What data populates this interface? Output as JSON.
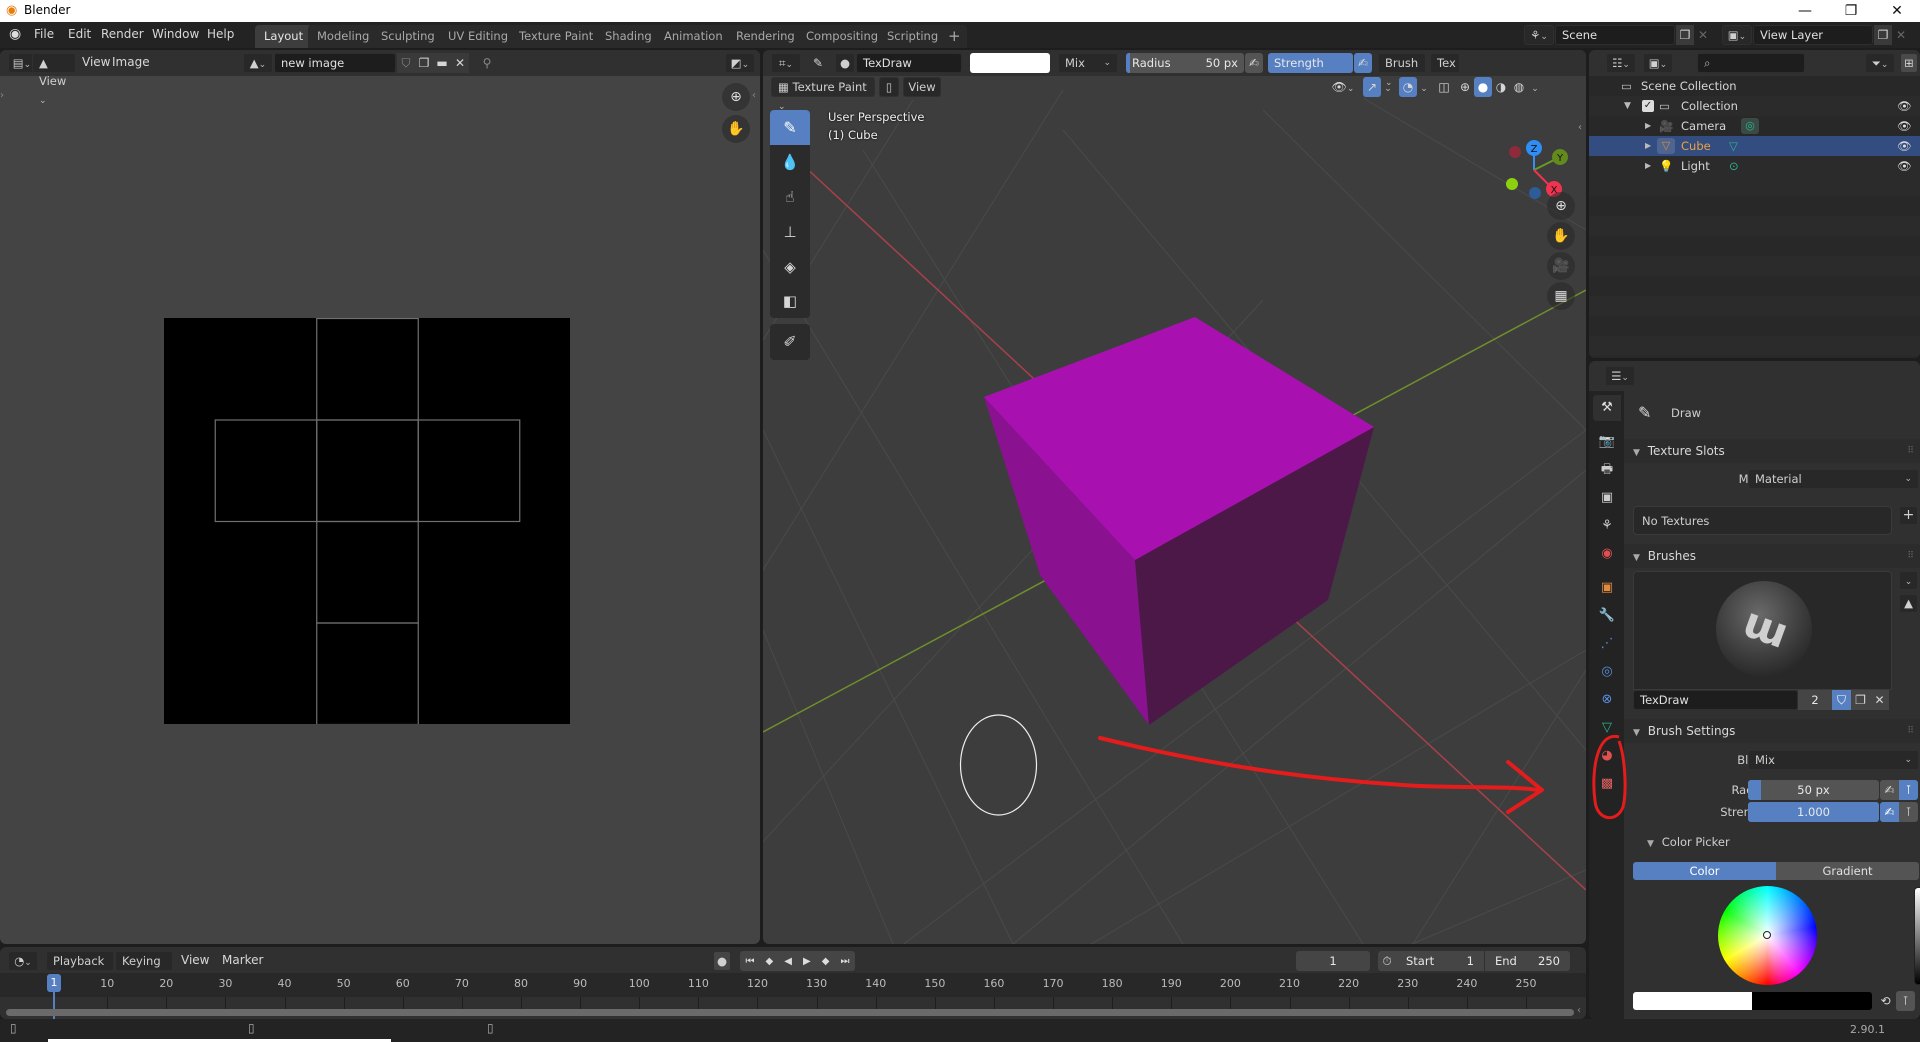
{
  "window": {
    "title": "Blender",
    "controls": [
      "minimize",
      "restore",
      "close"
    ]
  },
  "menu": {
    "items": [
      "File",
      "Edit",
      "Render",
      "Window",
      "Help"
    ]
  },
  "workspaces": {
    "tabs": [
      "Layout",
      "Modeling",
      "Sculpting",
      "UV Editing",
      "Texture Paint",
      "Shading",
      "Animation",
      "Rendering",
      "Compositing",
      "Scripting"
    ],
    "active": "Layout",
    "add_label": "+"
  },
  "scene_selector": {
    "value": "Scene"
  },
  "view_layer_selector": {
    "value": "View Layer"
  },
  "image_editor": {
    "mode_label": "View",
    "menus": [
      "View",
      "Image"
    ],
    "image_name": "new image",
    "uv_island_color": "#707070"
  },
  "viewport": {
    "brush_name": "TexDraw",
    "brush_color": "#ffffff",
    "blend_mode": "Mix",
    "radius_label": "Radius",
    "radius_value": "50 px",
    "strength_label": "Strength",
    "strength_value": "1.000",
    "brush_menu": "Brush",
    "texture_menu_truncated": "Tex",
    "mode": "Texture Paint",
    "view_menu": "View",
    "overlay_text_1": "User Perspective",
    "overlay_text_2": "(1) Cube",
    "cube_color": "#a811b0",
    "gizmo": {
      "x": "X",
      "y": "Y",
      "z": "Z"
    },
    "tools": [
      "draw",
      "soften",
      "smear",
      "clone",
      "fill",
      "mask",
      "annotate"
    ]
  },
  "outliner": {
    "root": "Scene Collection",
    "items": [
      {
        "name": "Collection",
        "type": "collection",
        "level": 1
      },
      {
        "name": "Camera",
        "type": "camera",
        "level": 2
      },
      {
        "name": "Cube",
        "type": "mesh",
        "level": 2,
        "selected": true
      },
      {
        "name": "Light",
        "type": "light",
        "level": 2
      }
    ]
  },
  "properties": {
    "tool_name": "Draw",
    "texture_slots": {
      "title": "Texture Slots",
      "mode_label": "Mode",
      "mode_value": "Material",
      "empty_label": "No Textures"
    },
    "brushes": {
      "title": "Brushes",
      "brush_name": "TexDraw",
      "users": "2"
    },
    "brush_settings": {
      "title": "Brush Settings",
      "blend_label": "Blend",
      "blend_value": "Mix",
      "radius_label": "Radius",
      "radius_value": "50 px",
      "radius_fraction": 0.1,
      "strength_label": "Strength",
      "strength_value": "1.000",
      "strength_fraction": 1.0
    },
    "color_picker": {
      "title": "Color Picker",
      "tab_color": "Color",
      "tab_gradient": "Gradient",
      "active_tab": "Color",
      "primary": "#ffffff",
      "secondary": "#000000"
    }
  },
  "timeline": {
    "menus": [
      "Playback",
      "Keying",
      "View",
      "Marker"
    ],
    "current_frame": "1",
    "start_label": "Start",
    "start_value": "1",
    "end_label": "End",
    "end_value": "250",
    "ticks": [
      "10",
      "20",
      "30",
      "40",
      "50",
      "60",
      "70",
      "80",
      "90",
      "100",
      "110",
      "120",
      "130",
      "140",
      "150",
      "160",
      "170",
      "180",
      "190",
      "200",
      "210",
      "220",
      "230",
      "240",
      "250"
    ]
  },
  "statusbar": {
    "version": "2.90.1"
  },
  "annotation": {
    "color": "#e41c1c"
  }
}
